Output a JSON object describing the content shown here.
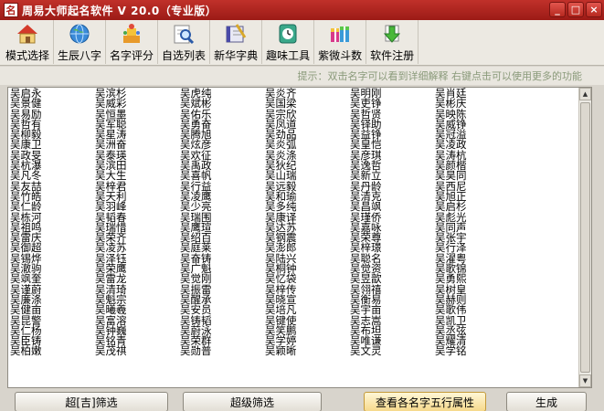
{
  "window": {
    "icon_glyph": "名",
    "title": "周易大师起名软件 V 20.0（专业版）",
    "buttons": [
      "_",
      "□",
      "×"
    ]
  },
  "toolbar": [
    {
      "label": "模式选择",
      "icon": "house-icon"
    },
    {
      "label": "生辰八字",
      "icon": "globe-icon"
    },
    {
      "label": "名字评分",
      "icon": "trophy-icon"
    },
    {
      "label": "自选列表",
      "icon": "magnifier-icon"
    },
    {
      "label": "新华字典",
      "icon": "dictionary-icon"
    },
    {
      "label": "趣味工具",
      "icon": "clock-icon"
    },
    {
      "label": "紫微斗数",
      "icon": "gift-icon"
    },
    {
      "label": "软件注册",
      "icon": "arrow-down-icon"
    }
  ],
  "hint": "提示：双击名字可以看到详细解释    右键点击可以使用更多的功能",
  "names": [
    [
      "吴启永",
      "吴滨杉",
      "吴虎纯",
      "吴炎齐",
      "吴明刚",
      "吴肖廷"
    ],
    [
      "吴景健",
      "吴威彩",
      "吴斌彬",
      "吴国梁",
      "吴吏铮",
      "吴彬庆"
    ],
    [
      "吴易励",
      "吴恒墨",
      "吴佑乐",
      "吴宗欣",
      "吴哲贤",
      "吴映陈"
    ],
    [
      "吴哲有",
      "吴军聪",
      "吴勇奋",
      "吴凤道",
      "吴铎助",
      "吴威铮"
    ],
    [
      "吴柳毅",
      "吴星涛",
      "吴腾旭",
      "吴劲品",
      "吴益铮",
      "吴冠溢"
    ],
    [
      "吴康卫",
      "吴洲奋",
      "吴炫彦",
      "吴炎弧",
      "吴皇恺",
      "吴凌政"
    ],
    [
      "吴政旻",
      "吴泰瑛",
      "吴欢征",
      "吴炎涤",
      "吴彦琪",
      "吴涛杭"
    ],
    [
      "吴杭瀑",
      "吴滨田",
      "吴禹政",
      "吴狄纪",
      "吴逸哲",
      "吴颜楷"
    ],
    [
      "吴凡冬",
      "吴大生",
      "吴喜帆",
      "吴山瑞",
      "吴新立",
      "吴昊同"
    ],
    [
      "吴友喆",
      "吴梓君",
      "吴行益",
      "吴远毅",
      "吴丹龄",
      "吴西尼"
    ],
    [
      "吴竹皓",
      "吴天利",
      "吴凌鹰",
      "吴和瑜",
      "吴清克",
      "吴旭正"
    ],
    [
      "吴仁龄",
      "吴羽峰",
      "吴少亮",
      "吴多纯",
      "吴昌飒",
      "吴启杉"
    ],
    [
      "吴栋河",
      "吴韬春",
      "吴瑞围",
      "吴康译",
      "吴瑾侨",
      "吴彪光"
    ],
    [
      "吴祖鸣",
      "吴瑞惜",
      "吴鹰瑄",
      "吴达苏",
      "吴嘉咏",
      "吴同声"
    ],
    [
      "吴雷庆",
      "吴荣齐",
      "吴绍百",
      "吴钢震",
      "吴荣尊",
      "吴张宇"
    ],
    [
      "吴御超",
      "吴凌苏",
      "吴庭莱",
      "吴澎郎",
      "吴梓璟",
      "吴行泽"
    ],
    [
      "吴锡烨",
      "吴泽钰",
      "吴奋铸",
      "吴陆兴",
      "吴聪名",
      "吴濯粤"
    ],
    [
      "吴澈驹",
      "吴荣鹰",
      "吴广魁",
      "吴桐钟",
      "吴觉资",
      "吴歌锦"
    ],
    [
      "吴飒奎",
      "吴雷龙",
      "吴觉刚",
      "吴忆袋",
      "吴昱歆",
      "吴勇熙"
    ],
    [
      "吴谨蔚",
      "吴清琦",
      "吴振雷",
      "吴梓传",
      "吴翎禧",
      "吴树皇"
    ],
    [
      "吴廉涤",
      "吴魁宗",
      "吴醒承",
      "吴晓宣",
      "吴衡易",
      "吴赫则"
    ],
    [
      "吴健亩",
      "吴曦羲",
      "吴安员",
      "吴培凡",
      "吴宇亩",
      "吴歌伟"
    ],
    [
      "吴昆警",
      "吴富溶",
      "吴铸韬",
      "吴键使",
      "吴志嵩",
      "吴凯卫"
    ],
    [
      "吴仁杨",
      "吴钟巍",
      "吴蔚泳",
      "吴笑鹏",
      "吴布坦",
      "吴丞弦"
    ],
    [
      "吴臣铸",
      "吴铭青",
      "吴荣群",
      "吴学婷",
      "吴唯谦",
      "吴耀清"
    ],
    [
      "吴柏嫩",
      "吴茂祺",
      "吴勋普",
      "吴颖晰",
      "吴文灵",
      "吴学铭"
    ]
  ],
  "bottom_buttons": [
    "超[吉]筛选",
    "超级筛选",
    "查看各名字五行属性",
    "生成"
  ]
}
